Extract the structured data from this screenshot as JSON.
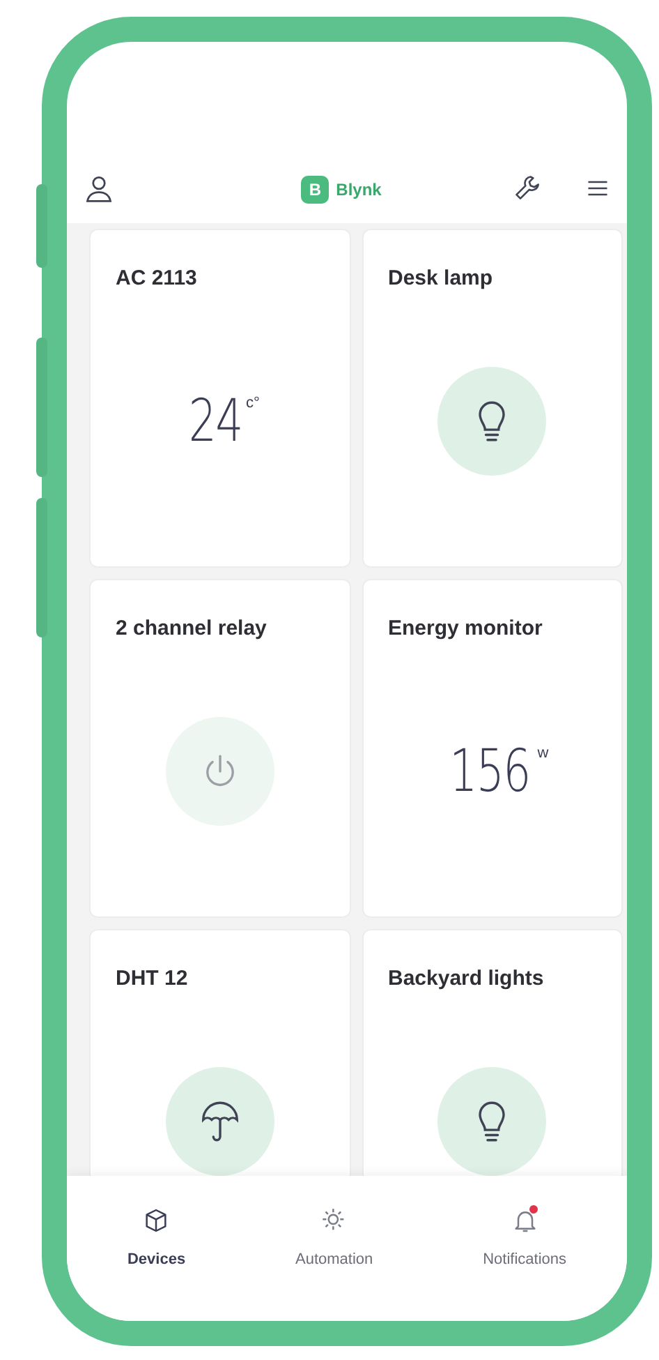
{
  "header": {
    "logo_letter": "B",
    "logo_text": "Blynk"
  },
  "tiles": [
    {
      "name": "AC 2113",
      "kind": "value",
      "value": "24",
      "unit": "c°"
    },
    {
      "name": "Desk lamp",
      "kind": "light",
      "on": true
    },
    {
      "name": "2 channel relay",
      "kind": "power",
      "on": false
    },
    {
      "name": "Energy monitor",
      "kind": "value",
      "value": "156",
      "unit": "w"
    },
    {
      "name": "DHT 12",
      "kind": "umbrella",
      "on": true
    },
    {
      "name": "Backyard lights",
      "kind": "light",
      "on": true
    }
  ],
  "nav": [
    {
      "label": "Devices",
      "kind": "devices",
      "selected": true
    },
    {
      "label": "Automation",
      "kind": "automation",
      "selected": false
    },
    {
      "label": "Notifications",
      "kind": "notifications",
      "selected": false,
      "badge": true
    }
  ]
}
